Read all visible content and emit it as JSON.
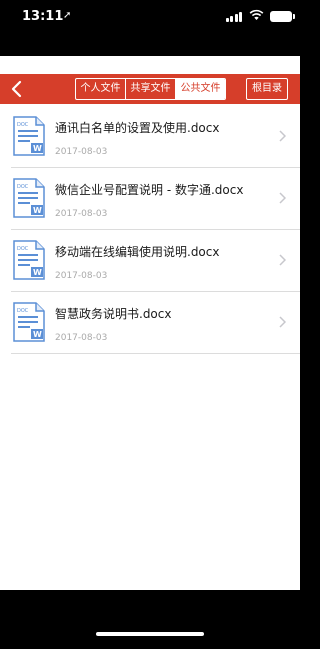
{
  "status": {
    "time": "13:11"
  },
  "nav": {
    "tabs": [
      {
        "label": "个人文件",
        "active": false
      },
      {
        "label": "共享文件",
        "active": false
      },
      {
        "label": "公共文件",
        "active": true
      }
    ],
    "root_label": "根目录"
  },
  "files": [
    {
      "name": "通讯白名单的设置及使用.docx",
      "date": "2017-08-03",
      "icon": "word-doc-icon"
    },
    {
      "name": "微信企业号配置说明 - 数字通.docx",
      "date": "2017-08-03",
      "icon": "word-doc-icon"
    },
    {
      "name": "移动端在线编辑使用说明.docx",
      "date": "2017-08-03",
      "icon": "word-doc-icon"
    },
    {
      "name": "智慧政务说明书.docx",
      "date": "2017-08-03",
      "icon": "word-doc-icon"
    }
  ],
  "colors": {
    "accent": "#d63e2a",
    "doc_icon": "#5b8fd6"
  }
}
